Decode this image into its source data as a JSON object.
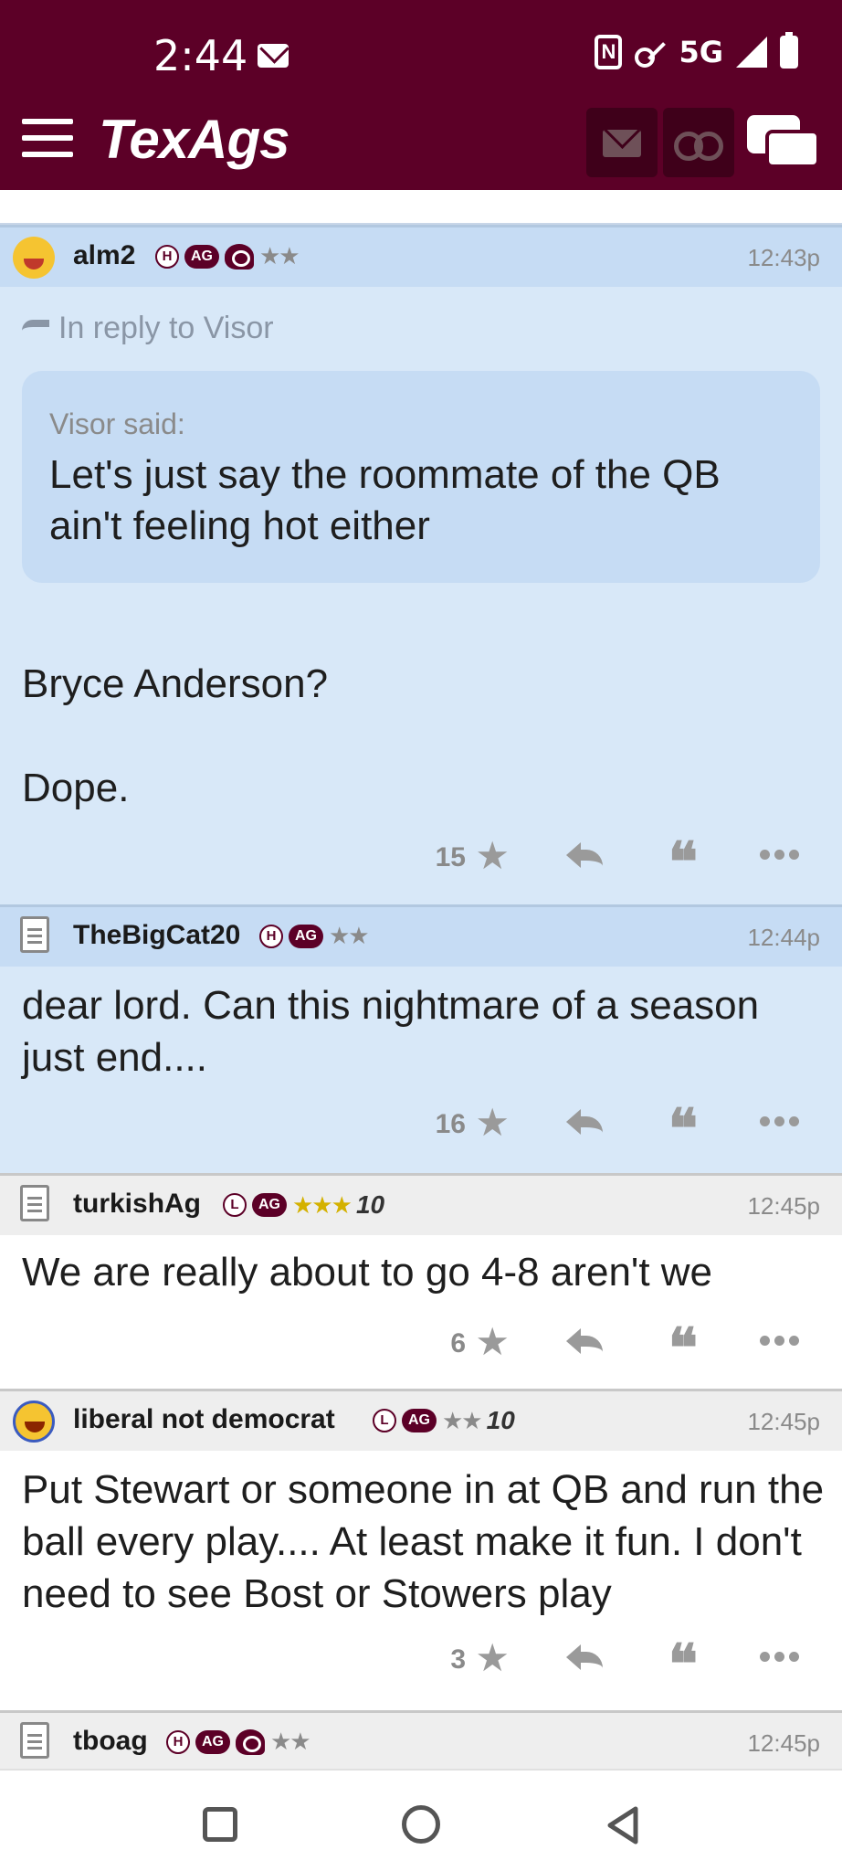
{
  "status_bar": {
    "time": "2:44",
    "network": "5G",
    "icons": [
      "mail-icon",
      "nfc-icon",
      "key-icon",
      "signal-icon",
      "battery-icon"
    ]
  },
  "header": {
    "logo": "TexAgs",
    "icons": [
      "menu-icon",
      "message-icon",
      "binoculars-icon",
      "chat-icon"
    ],
    "colors": {
      "brand": "#5c0027"
    }
  },
  "posts": [
    {
      "user": "alm2",
      "time": "12:43p",
      "badges": [
        "H",
        "AG"
      ],
      "stars": "★★",
      "reply_to": "In reply to Visor",
      "quote_author": "Visor said:",
      "quote_text": "Let's just say the roommate of the QB ain't feeling hot either",
      "body_1": "Bryce Anderson?",
      "body_2": "Dope.",
      "rating": "15"
    },
    {
      "user": "TheBigCat20",
      "time": "12:44p",
      "badges": [
        "H",
        "AG"
      ],
      "stars": "★★",
      "body": "dear lord. Can this nightmare of a season just end....",
      "rating": "16"
    },
    {
      "user": "turkishAg",
      "time": "12:45p",
      "badges": [
        "L",
        "AG"
      ],
      "stars": "★★★",
      "level": "10",
      "body": "We are really about to go 4-8 aren't we",
      "rating": "6"
    },
    {
      "user": "liberal not democrat",
      "time": "12:45p",
      "badges": [
        "L",
        "AG"
      ],
      "stars": "★★",
      "level": "10",
      "body": "Put Stewart or someone in at QB and run the ball every play.... At least make it fun. I don't need to see Bost or Stowers play",
      "rating": "3"
    },
    {
      "user": "tboag",
      "time": "12:45p",
      "badges": [
        "H",
        "AG"
      ],
      "stars": "★★"
    }
  ],
  "actions": {
    "star": "★",
    "quote": "❝"
  },
  "navbar": {
    "icons": [
      "recents-square-icon",
      "home-circle-icon",
      "back-triangle-icon"
    ]
  }
}
